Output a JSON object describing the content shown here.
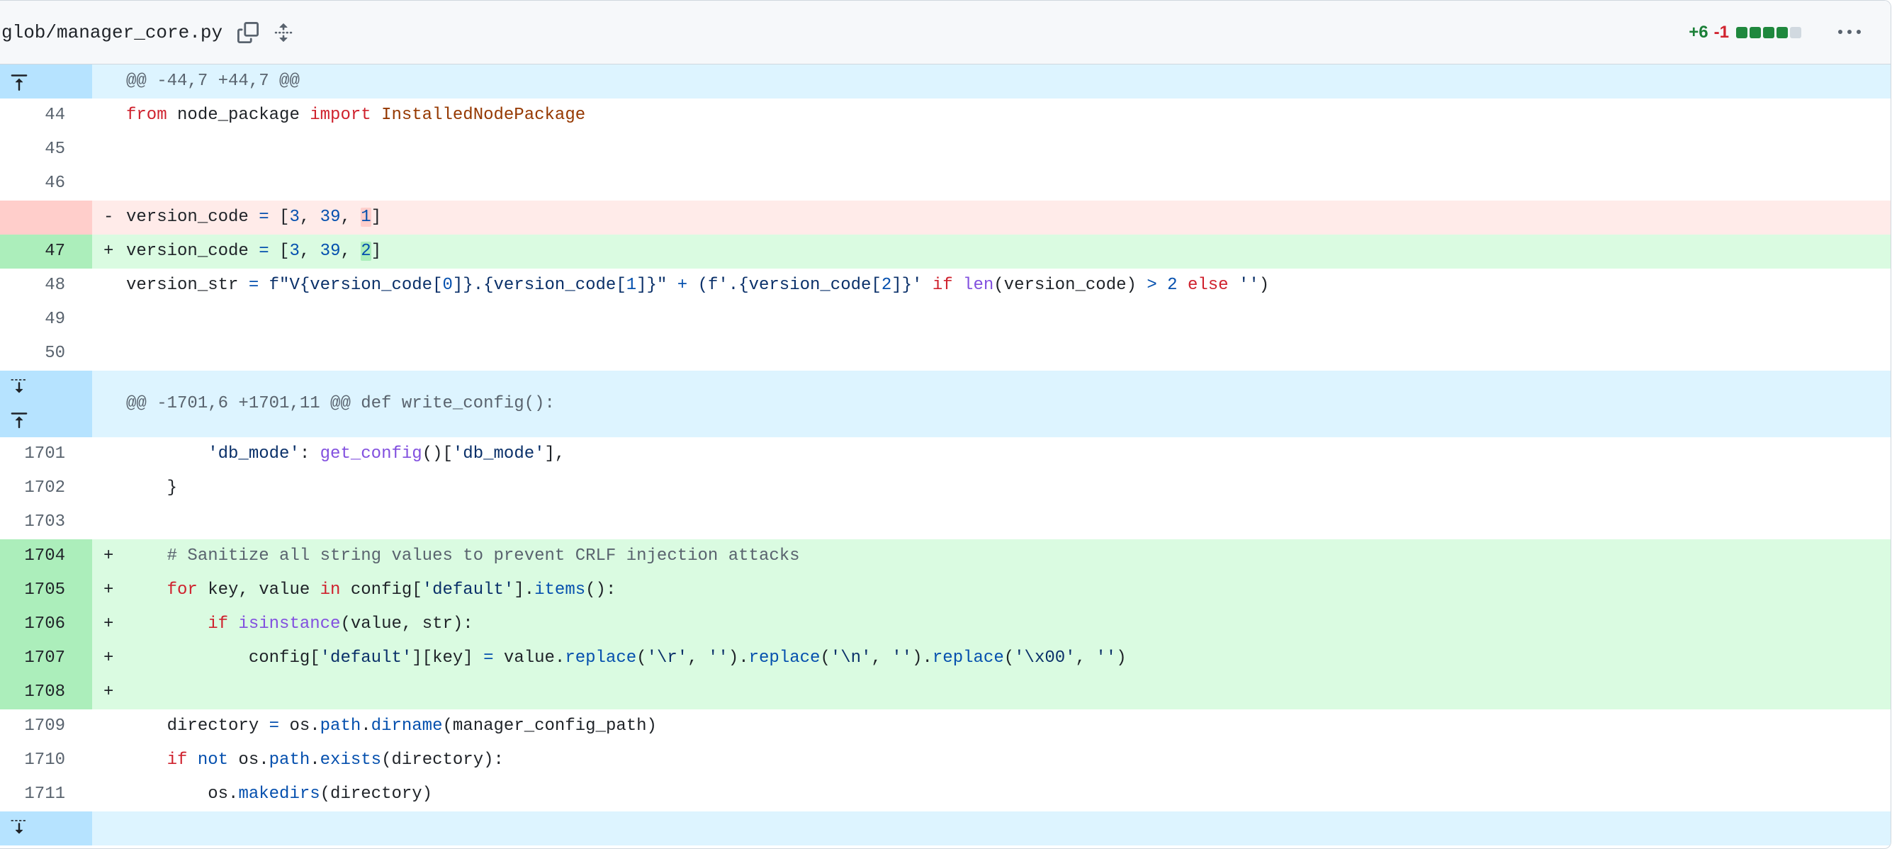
{
  "header": {
    "file_path": "glob/manager_core.py",
    "additions": "+6",
    "deletions": "-1",
    "stat_blocks": [
      "add",
      "add",
      "add",
      "add",
      "neutral"
    ],
    "icons": {
      "copy": "copy-icon",
      "expand": "unfold-icon",
      "more": "kebab-horizontal-icon"
    }
  },
  "colors": {
    "add_bg": "#dafbe1",
    "add_num_bg": "#aceebb",
    "del_bg": "#ffebe9",
    "del_num_bg": "#ffcecb",
    "hunk_bg": "#ddf4ff",
    "hunk_num_bg": "#b6e3ff"
  },
  "hunks": {
    "h1": "@@ -44,7 +44,7 @@",
    "h2": "@@ -1701,6 +1701,11 @@ def write_config():"
  },
  "lines": {
    "l44": "44",
    "l45": "45",
    "l46": "46",
    "l47": "47",
    "l48": "48",
    "l49": "49",
    "l50": "50",
    "l1701": "1701",
    "l1702": "1702",
    "l1703": "1703",
    "l1704": "1704",
    "l1705": "1705",
    "l1706": "1706",
    "l1707": "1707",
    "l1708": "1708",
    "l1709": "1709",
    "l1710": "1710",
    "l1711": "1711"
  },
  "markers": {
    "minus": "-",
    "plus": "+"
  },
  "tok": {
    "from": "from",
    "node_package": " node_package ",
    "import": "import",
    "InstalledNodePackage": " InstalledNodePackage",
    "version_code": "version_code ",
    "eq": "=",
    "lb": " [",
    "n3": "3",
    "comma": ", ",
    "n39": "39",
    "n1": "1",
    "n2": "2",
    "rb": "]",
    "version_str": "version_str ",
    "fstr_open": " f\"V{version_code[",
    "n0": "0",
    "fstr_mid1": "]}.{version_code[",
    "fstr_mid1b": "1",
    "fstr_close": "]}\"",
    "plus_op": " + ",
    "paren_f": "(f'.{version_code[",
    "n2b": "2",
    "fstr2_close": "]}' ",
    "if": "if",
    "len": " len",
    "len_arg": "(version_code) ",
    "gt": ">",
    "sp": " ",
    "n2c": "2",
    "else": "else",
    "empty": " ''",
    "rparen": ")",
    "db_mode_key": "'db_mode'",
    "colon": ": ",
    "get_config": "get_config",
    "gc_args": "()[",
    "db_mode_key2": "'db_mode'",
    "gc_end": "],",
    "brace": "}",
    "comment": "# Sanitize all string values to prevent CRLF injection attacks",
    "for": "for",
    "kv": " key, value ",
    "in": "in",
    "config": " config[",
    "default": "'default'",
    "dot_items": "].",
    "items": "items",
    "items_end": "():",
    "isinstance": " isinstance",
    "isinst_args": "(value, str):",
    "config2": "config[",
    "key_part": "][key] ",
    "value_dot": " value.",
    "replace": "replace",
    "r_arg": "'\\r'",
    "r_sep": ", ",
    "empty2": "''",
    "rp_dot": ").",
    "n_arg": "'\\n'",
    "x00_arg": "'\\x00'",
    "directory": "directory ",
    "os_dot": " os.",
    "path": "path",
    "dot": ".",
    "dirname": "dirname",
    "dirname_arg": "(manager_config_path)",
    "not": " not",
    "exists": "exists",
    "exists_arg": "(directory):",
    "os_dot2": "os.",
    "makedirs": "makedirs",
    "makedirs_arg": "(directory)"
  }
}
